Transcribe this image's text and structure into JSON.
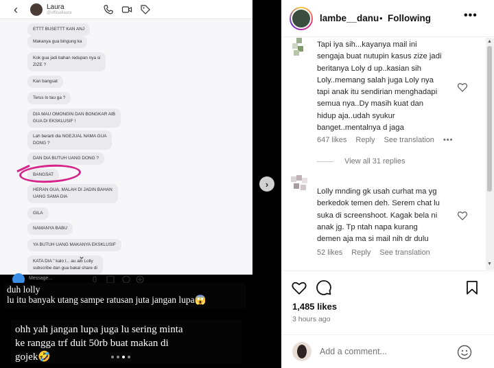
{
  "post_image": {
    "chat_name": "Laura",
    "chat_handle": "@officiallaura",
    "messages": [
      "ETTT BUSETTT KAN ANJ",
      "Makanya gua bingung ka",
      "Kok gua jadi bahan redupan nya si\nZIZE ?",
      "Kan bangsat",
      "Terus lo tau ga ?",
      "DIA MAU OMONGIN DAN BONGKAR AIB\nGUA DI EKSKLUSIF !",
      "Lah berarti dia NGEJUAL NAMA GUA\nDONG ?",
      "DAN DIA BUTUH UANG DONG ?",
      "BANGSAT",
      "HERAN GUA, MALAH DI JADIN BAHAN\nUANG SAMA DIA",
      "GILA",
      "NAMANYA BABU",
      "YA BUTUH UANG MAKANYA EKSKLUSIF",
      "KATA DIA \" kalo l... au aib Lolly\nsubscribe dan gua bakal share di"
    ],
    "message_placeholder": "Message...",
    "caption_1": "duh lolly\nlu itu banyak utang sampe ratusan juta jangan lupa😱",
    "caption_2": "ohh yah jangan lupa juga lu sering minta\nke rangga trf duit 50rb buat makan di\ngojek🤣",
    "slide_count": 4,
    "active_slide": 2
  },
  "header": {
    "account": "lambe__danu",
    "separator": "•",
    "follow_state": "Following",
    "more": "•••"
  },
  "comments": [
    {
      "text": "Tapi iya sih...kayanya mail ini\nsengaja buat nutupin kasus zize jadi\nberitanya Loly d up..kasian sih\nLoly..memang salah juga Loly nya\ntapi anak itu sendirian menghadapi\nsemua nya..Dy masih kuat dan\nhidup aja..udah syukur\nbanget..mentalnya d jaga",
      "likes": "647 likes",
      "reply": "Reply",
      "translate": "See translation",
      "more": "•••"
    },
    {
      "text": "Lolly mnding gk usah curhat ma yg\nberkedok temen deh. Serem chat lu\nsuka di screenshoot. Kagak bela ni\nanak jg. Tp ntah napa kurang\ndemen aja ma si mail nih dr dulu",
      "likes": "52 likes",
      "reply": "Reply",
      "translate": "See translation"
    }
  ],
  "view_replies": "View all 31 replies",
  "post_meta": {
    "likes": "1,485 likes",
    "time": "3 hours ago"
  },
  "add_comment": {
    "placeholder": "Add a comment..."
  },
  "colors": {
    "highlight_circle": "#d5248a",
    "meta_grey": "#737373"
  }
}
